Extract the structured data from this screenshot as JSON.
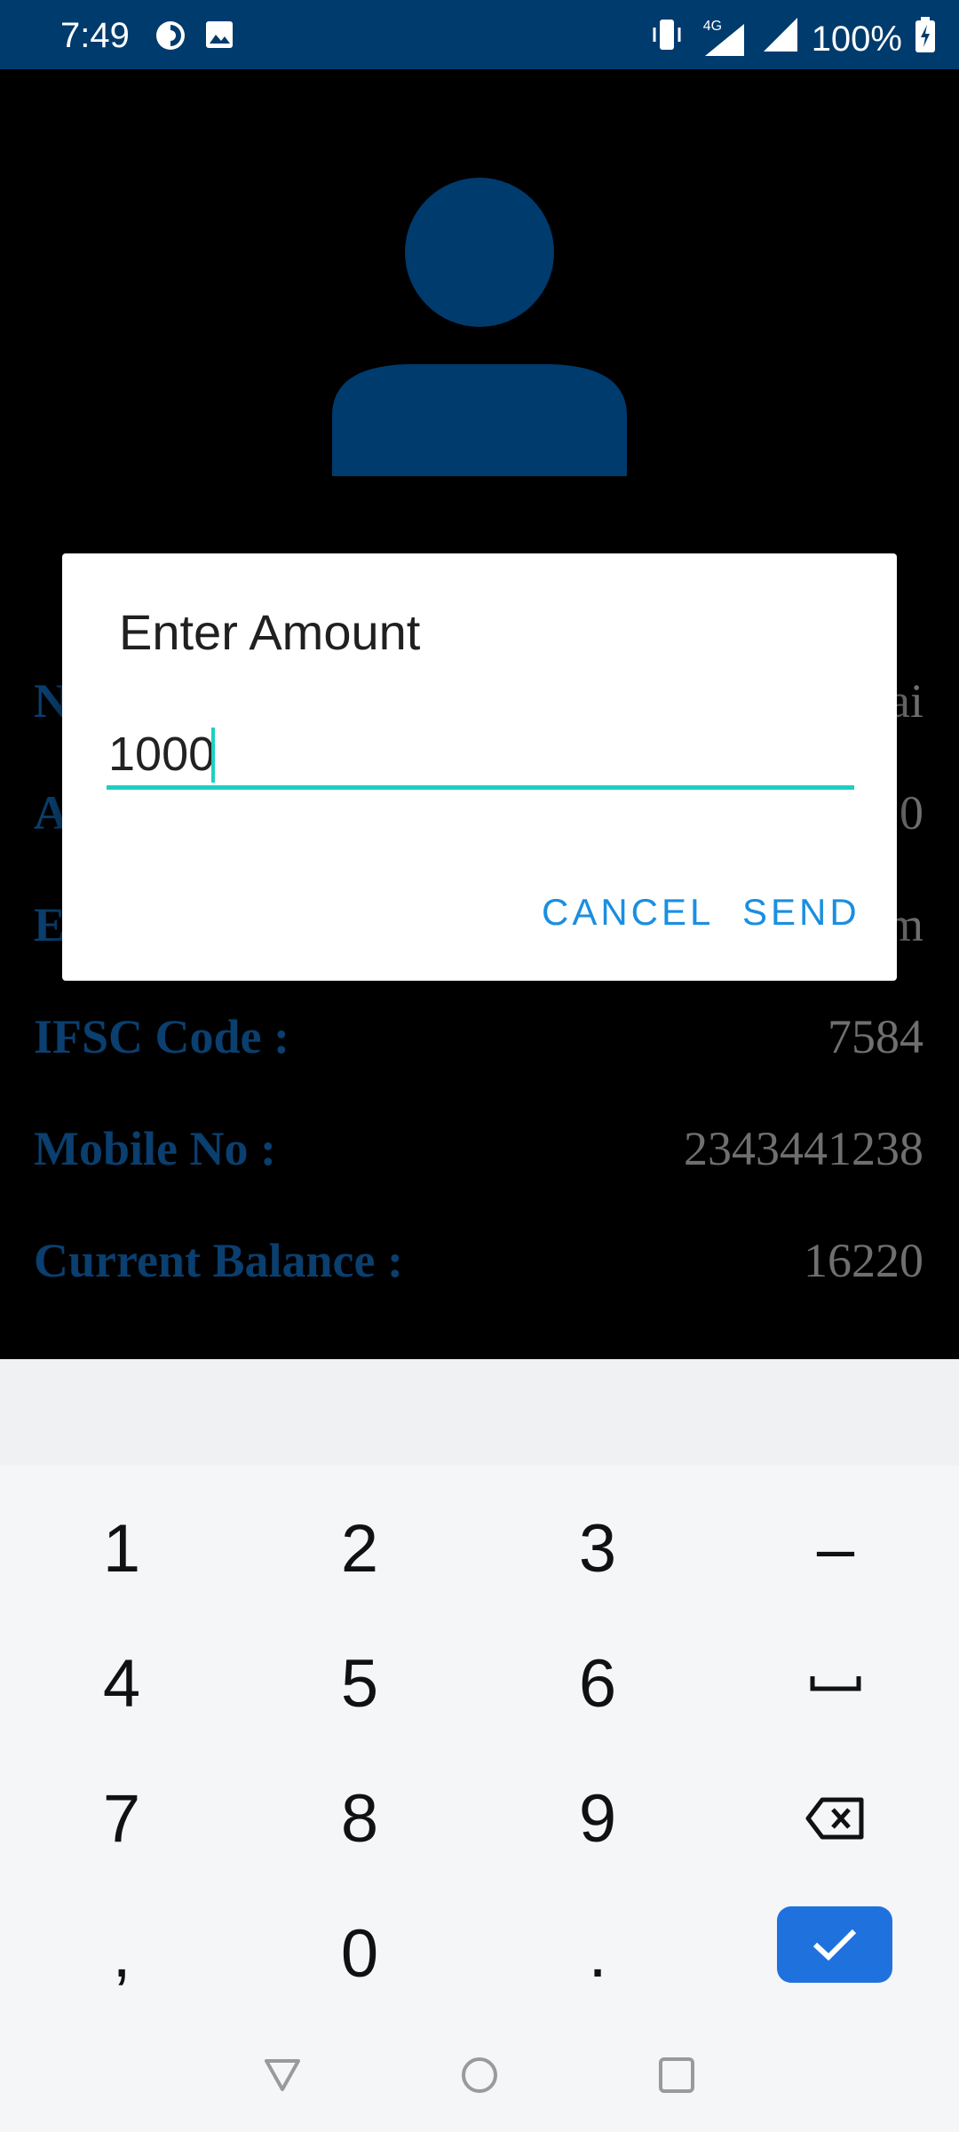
{
  "status_bar": {
    "time": "7:49",
    "network": "4G",
    "battery": "100%",
    "icons": [
      "data-saver-icon",
      "image-icon",
      "vibrate-icon",
      "signal-icon",
      "battery-charging-icon"
    ]
  },
  "profile": {
    "avatar_icon": "person-icon",
    "rows": [
      {
        "label": "N",
        "value": "ai"
      },
      {
        "label": "A",
        "value": "0"
      },
      {
        "label": "E",
        "value": "m"
      },
      {
        "label": "IFSC Code :",
        "value": "7584"
      },
      {
        "label": "Mobile No :",
        "value": "2343441238"
      },
      {
        "label": "Current Balance :",
        "value": "16220"
      }
    ]
  },
  "dialog": {
    "title": "Enter Amount",
    "amount_value": "1000",
    "cancel_label": "CANCEL",
    "send_label": "SEND"
  },
  "keyboard": {
    "keys": [
      "1",
      "2",
      "3",
      "–",
      "4",
      "5",
      "6",
      "␣",
      "7",
      "8",
      "9",
      "⌫",
      ",",
      "0",
      "."
    ],
    "enter_icon": "check-icon"
  },
  "nav_bar": {
    "icons": [
      "back-icon",
      "home-icon",
      "recents-icon"
    ]
  },
  "colors": {
    "primary": "#003b6e",
    "accent": "#1a8fe0",
    "underline": "#1fcfc1",
    "enter_key": "#1f72de"
  }
}
